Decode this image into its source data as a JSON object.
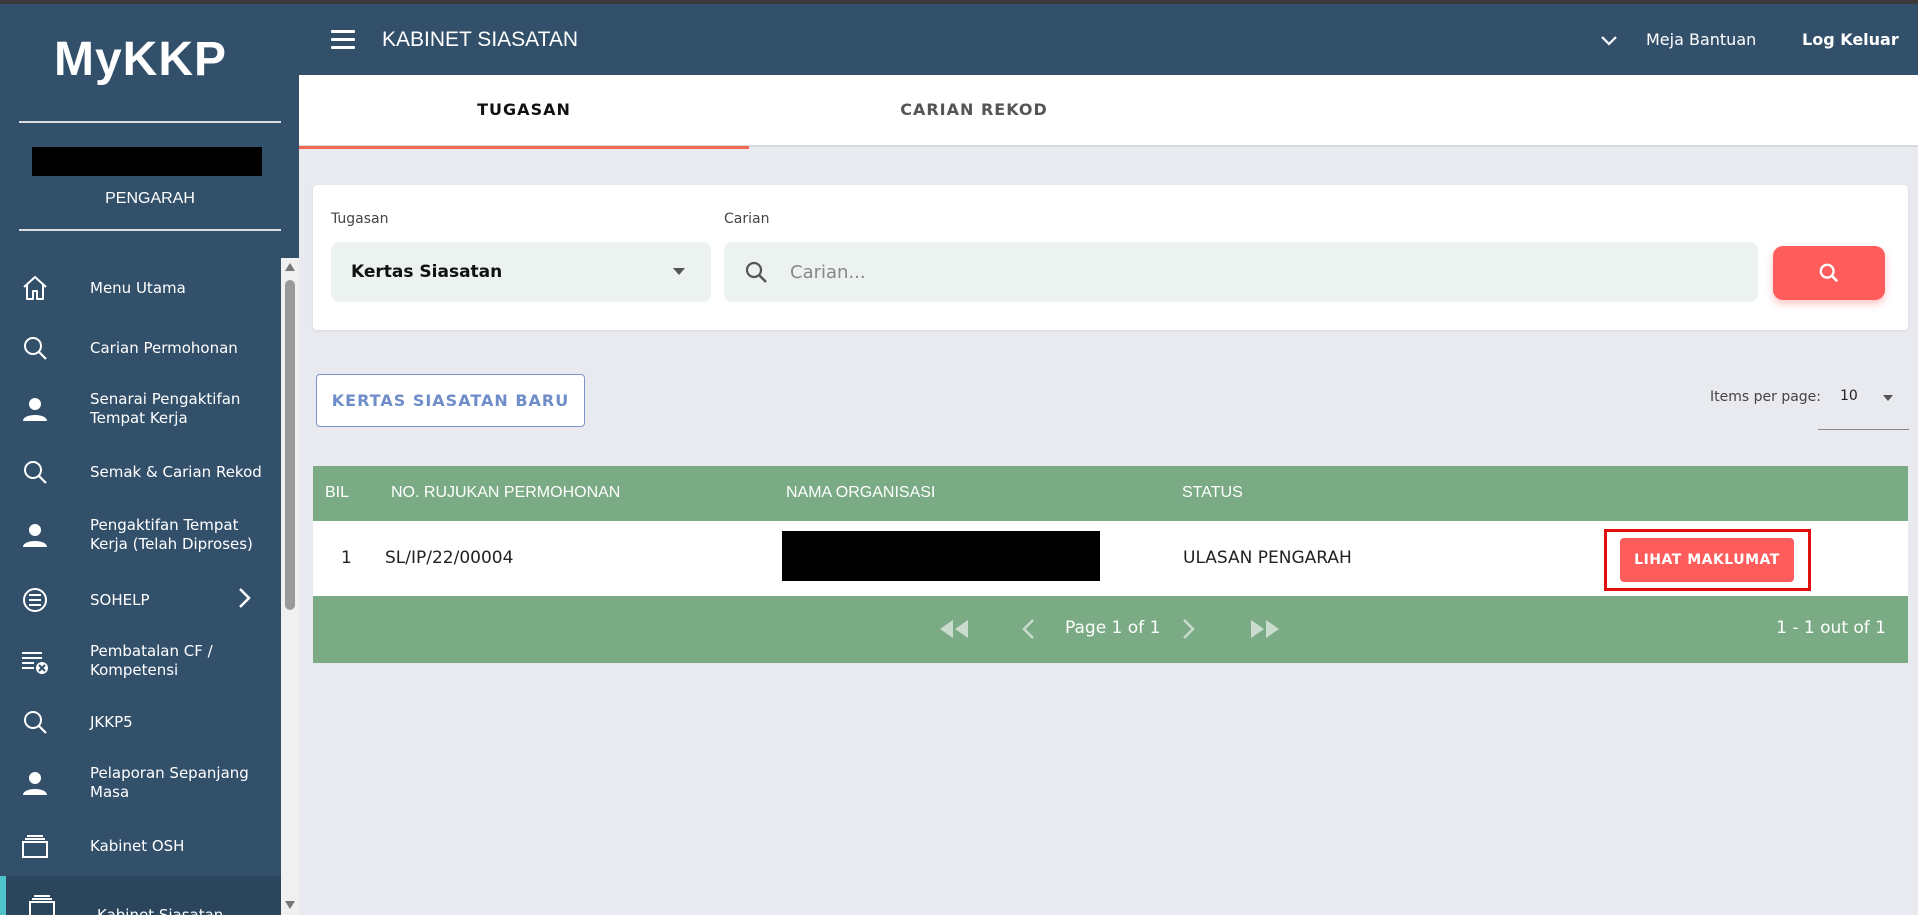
{
  "app": {
    "logo": "MyKKP",
    "role": "PENGARAH"
  },
  "sidebar": {
    "items": [
      {
        "label": "Menu Utama",
        "icon": "home-icon"
      },
      {
        "label": "Carian Permohonan",
        "icon": "search-icon"
      },
      {
        "label": "Senarai Pengaktifan Tempat Kerja",
        "icon": "person-icon"
      },
      {
        "label": "Semak & Carian Rekod",
        "icon": "search-icon"
      },
      {
        "label": "Pengaktifan Tempat Kerja (Telah Diproses)",
        "icon": "person-icon"
      },
      {
        "label": "SOHELP",
        "icon": "list-icon"
      },
      {
        "label": "Pembatalan CF / Kompetensi",
        "icon": "list-cancel-icon"
      },
      {
        "label": "JKKP5",
        "icon": "search-icon"
      },
      {
        "label": "Pelaporan Sepanjang Masa",
        "icon": "person-icon"
      },
      {
        "label": "Kabinet OSH",
        "icon": "cabinet-icon"
      },
      {
        "label": "Kabinet Siasatan",
        "icon": "cabinet-icon"
      }
    ]
  },
  "header": {
    "title": "KABINET SIASATAN",
    "help": "Meja Bantuan",
    "logout": "Log Keluar"
  },
  "tabs": [
    {
      "label": "TUGASAN",
      "active": true
    },
    {
      "label": "CARIAN REKOD",
      "active": false
    }
  ],
  "filter": {
    "task_label": "Tugasan",
    "task_value": "Kertas Siasatan",
    "search_label": "Carian",
    "search_placeholder": "Carian..."
  },
  "actions": {
    "new_button": "KERTAS SIASATAN BARU",
    "items_per_page_label": "Items per page:",
    "items_per_page_value": "10"
  },
  "table": {
    "columns": [
      "BIL",
      "NO. RUJUKAN PERMOHONAN",
      "NAMA ORGANISASI",
      "STATUS"
    ],
    "rows": [
      {
        "bil": "1",
        "ref": "SL/IP/22/00004",
        "org": "",
        "status": "ULASAN PENGARAH",
        "action": "LIHAT MAKLUMAT"
      }
    ],
    "pager": {
      "page_text": "Page 1 of 1",
      "range_text": "1 - 1 out of 1"
    }
  },
  "colors": {
    "sidebar_bg": "#33506b",
    "accent": "#ff5c5c",
    "table_header": "#7aab85",
    "tab_ink": "#f06a50"
  }
}
